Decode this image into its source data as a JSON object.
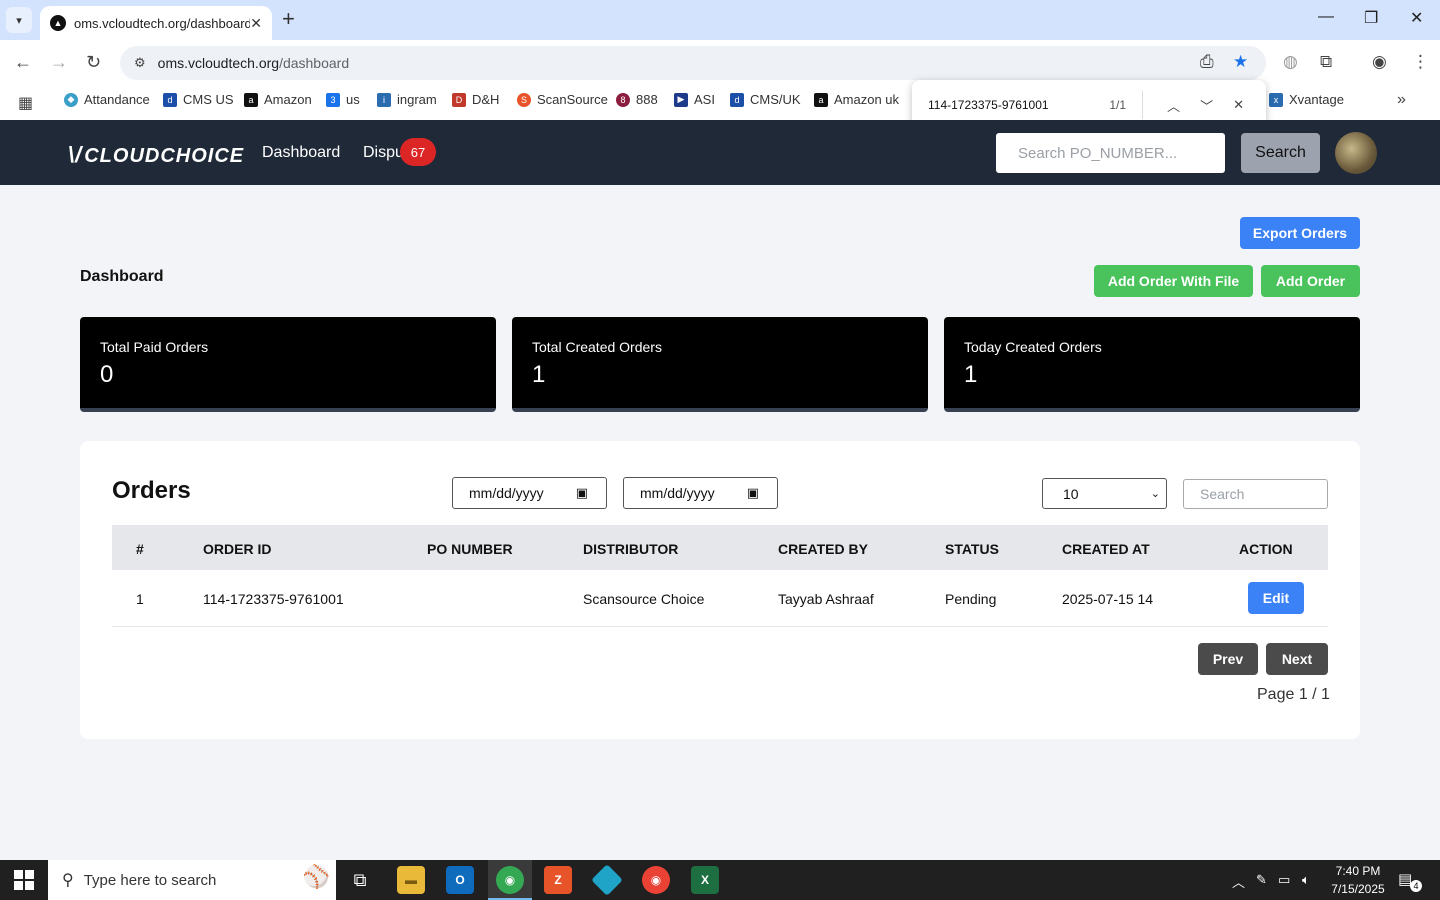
{
  "browser": {
    "tab_title": "oms.vcloudtech.org/dashboard",
    "url_host": "oms.vcloudtech.org",
    "url_path": "/dashboard",
    "bookmarks": [
      "Attandance",
      "CMS US",
      "Amazon",
      "us",
      "ingram",
      "D&H",
      "ScanSource",
      "888",
      "ASI",
      "CMS/UK",
      "Amazon uk",
      "Xvantage"
    ],
    "find": {
      "query": "114-1723375-9761001",
      "count": "1/1"
    }
  },
  "header": {
    "logo": "CLOUDCHOICE",
    "nav": [
      "Dashboard",
      "Dispu"
    ],
    "dispute_badge": "67",
    "po_search_placeholder": "Search PO_NUMBER...",
    "search_label": "Search"
  },
  "page": {
    "title": "Dashboard",
    "export_label": "Export Orders",
    "add_with_file_label": "Add Order With File",
    "add_order_label": "Add Order"
  },
  "stats": [
    {
      "label": "Total Paid Orders",
      "value": "0"
    },
    {
      "label": "Total Created Orders",
      "value": "1"
    },
    {
      "label": "Today Created Orders",
      "value": "1"
    }
  ],
  "orders": {
    "title": "Orders",
    "date_from": "mm/dd/yyyy",
    "date_to": "mm/dd/yyyy",
    "page_size": "10",
    "search_placeholder": "Search",
    "columns": [
      "#",
      "ORDER ID",
      "PO NUMBER",
      "DISTRIBUTOR",
      "CREATED BY",
      "STATUS",
      "CREATED AT",
      "ACTION"
    ],
    "rows": [
      {
        "num": "1",
        "order_id": "114-1723375-9761001",
        "po_number": "",
        "distributor": "Scansource Choice",
        "created_by": "Tayyab Ashraaf",
        "status": "Pending",
        "created_at": "2025-07-15 14",
        "action": "Edit"
      }
    ],
    "prev_label": "Prev",
    "next_label": "Next",
    "page_info": "Page 1 / 1"
  },
  "taskbar": {
    "search_placeholder": "Type here to search",
    "time": "7:40 PM",
    "date": "7/15/2025",
    "notifications": "4"
  },
  "colors": {
    "primary": "#3b82f6",
    "success": "#4ac35c",
    "header_bg": "#1f2937",
    "badge": "#dc2626"
  }
}
